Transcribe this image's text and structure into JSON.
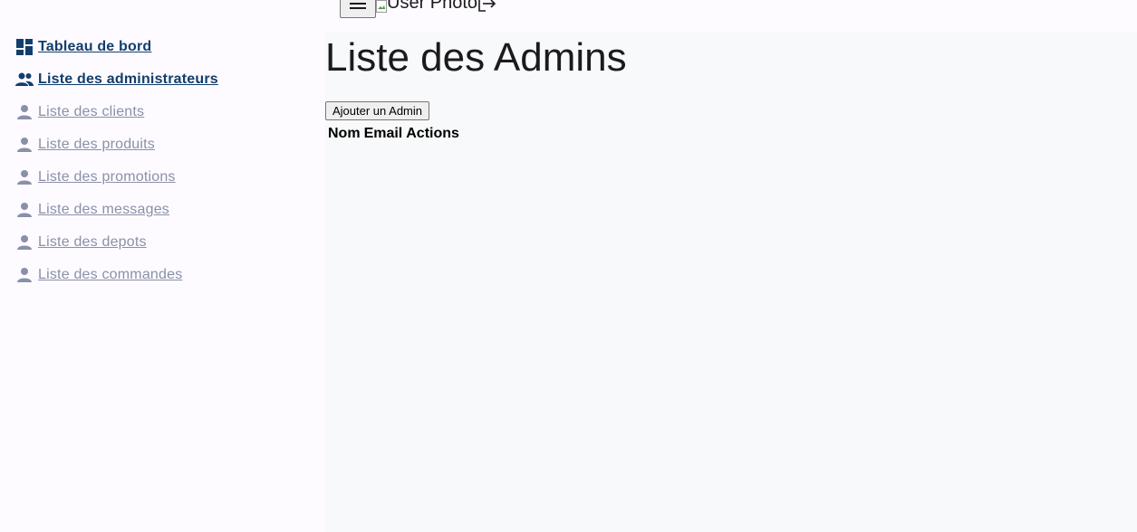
{
  "sidebar": {
    "items": [
      {
        "label": "Tableau de bord",
        "icon": "dashboard-icon",
        "active": true
      },
      {
        "label": "Liste des administrateurs",
        "icon": "group-icon",
        "active": true
      },
      {
        "label": "Liste des clients",
        "icon": "person-icon",
        "active": false
      },
      {
        "label": "Liste des produits",
        "icon": "person-icon",
        "active": false
      },
      {
        "label": "Liste des promotions",
        "icon": "person-icon",
        "active": false
      },
      {
        "label": "Liste des messages",
        "icon": "person-icon",
        "active": false
      },
      {
        "label": "Liste des depots",
        "icon": "person-icon",
        "active": false
      },
      {
        "label": "Liste des commandes",
        "icon": "person-icon",
        "active": false
      }
    ]
  },
  "topbar": {
    "user_photo_alt": "User Photo"
  },
  "main": {
    "title": "Liste des Admins",
    "add_button": "Ajouter un Admin",
    "table": {
      "headers": [
        "Nom",
        "Email",
        "Actions"
      ]
    }
  },
  "colors": {
    "active": "#123e6b",
    "inactive": "#8a90a8",
    "text": "#1b1b1f"
  }
}
